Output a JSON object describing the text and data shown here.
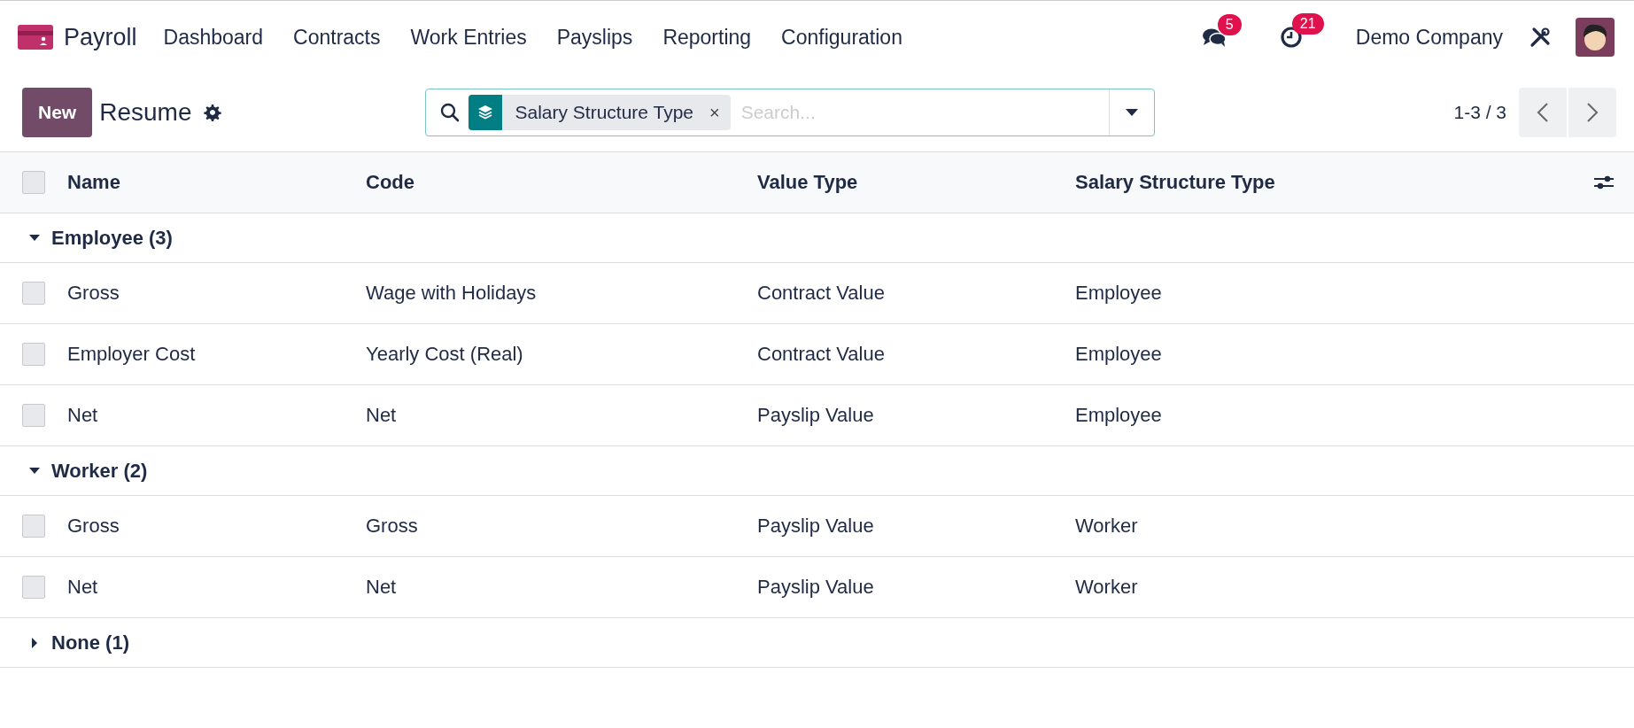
{
  "navbar": {
    "app_name": "Payroll",
    "menu": [
      "Dashboard",
      "Contracts",
      "Work Entries",
      "Payslips",
      "Reporting",
      "Configuration"
    ],
    "messages_badge": "5",
    "activities_badge": "21",
    "company": "Demo Company"
  },
  "control_panel": {
    "new_button": "New",
    "title": "Resume",
    "search": {
      "facet": "Salary Structure Type",
      "remove": "×",
      "placeholder": "Search..."
    },
    "pager": "1-3 / 3"
  },
  "table": {
    "columns": [
      "Name",
      "Code",
      "Value Type",
      "Salary Structure Type"
    ],
    "select_all_checked": false,
    "groups": [
      {
        "label": "Employee (3)",
        "expanded": true,
        "rows": [
          {
            "cells": [
              "Gross",
              "Wage with Holidays",
              "Contract Value",
              "Employee"
            ],
            "checked": false
          },
          {
            "cells": [
              "Employer Cost",
              "Yearly Cost (Real)",
              "Contract Value",
              "Employee"
            ],
            "checked": false
          },
          {
            "cells": [
              "Net",
              "Net",
              "Payslip Value",
              "Employee"
            ],
            "checked": false
          }
        ]
      },
      {
        "label": "Worker (2)",
        "expanded": true,
        "rows": [
          {
            "cells": [
              "Gross",
              "Gross",
              "Payslip Value",
              "Worker"
            ],
            "checked": false
          },
          {
            "cells": [
              "Net",
              "Net",
              "Payslip Value",
              "Worker"
            ],
            "checked": false
          }
        ]
      },
      {
        "label": "None (1)",
        "expanded": false
      }
    ]
  }
}
